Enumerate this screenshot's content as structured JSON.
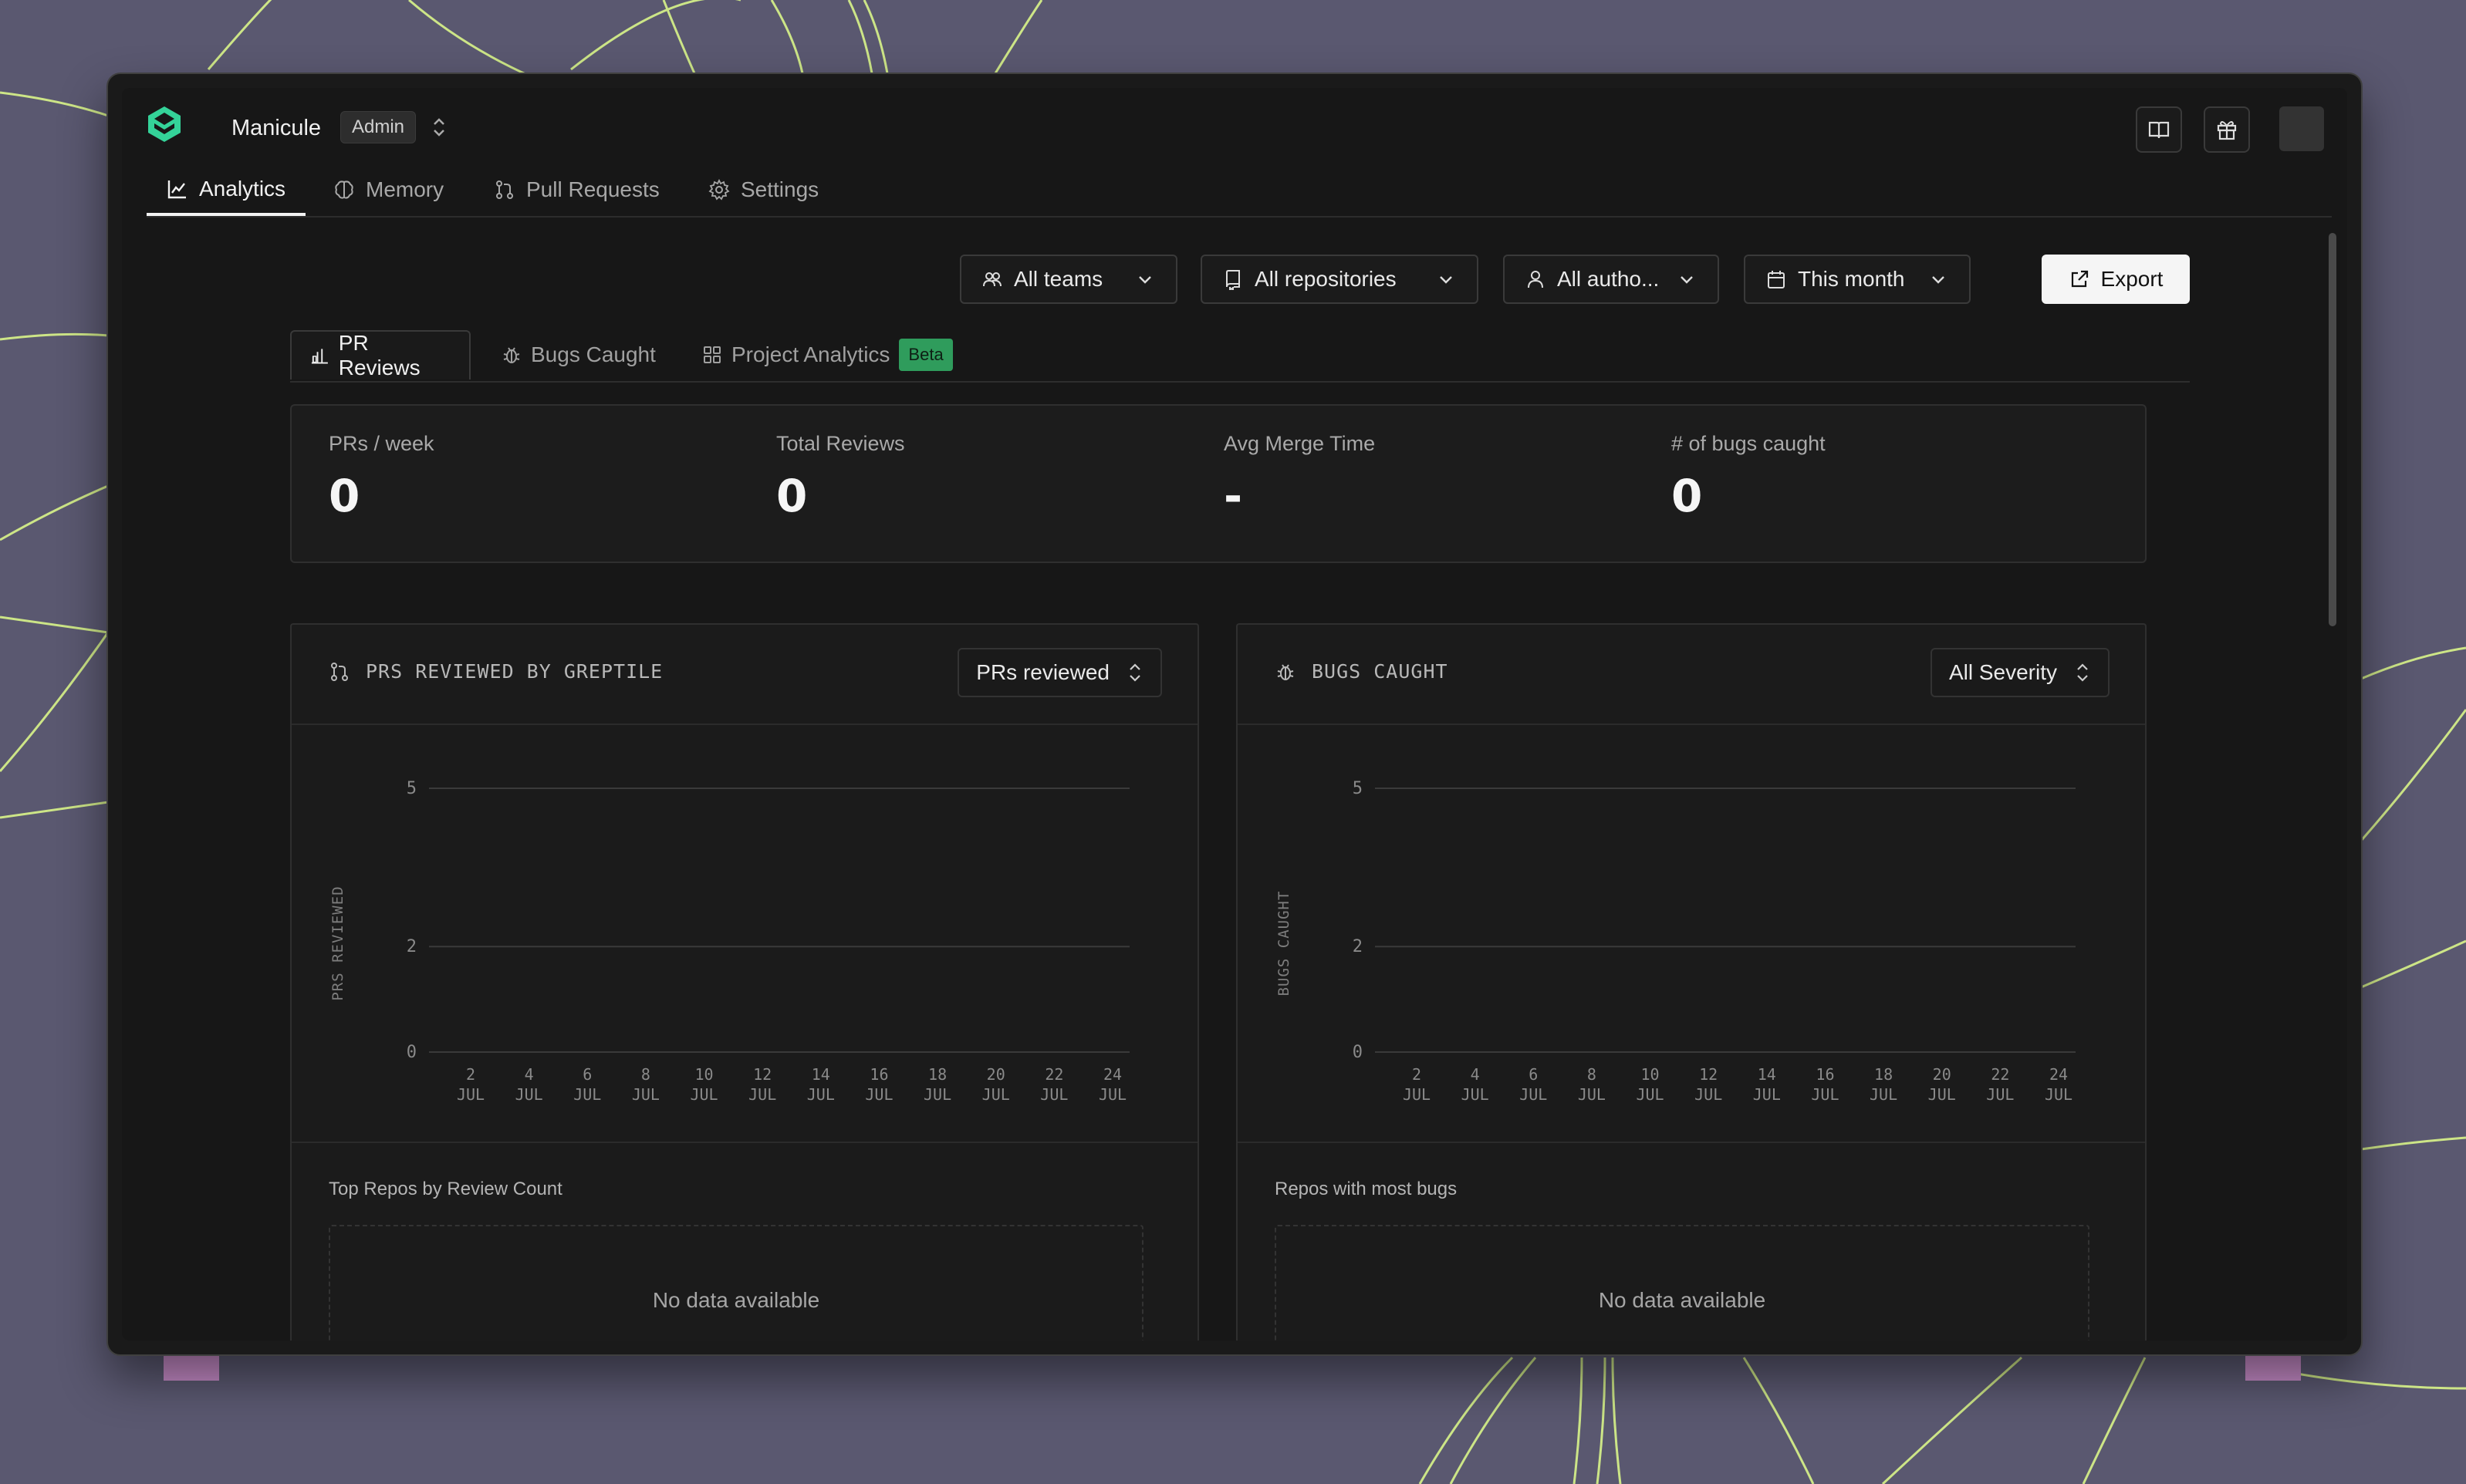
{
  "org": {
    "name": "Manicule",
    "role": "Admin"
  },
  "icons": {
    "logo": "greptile-logo-icon",
    "docs": "book-open-icon",
    "gift": "gift-icon"
  },
  "nav": {
    "tabs": [
      {
        "label": "Analytics",
        "icon": "chart-line-icon",
        "active": true
      },
      {
        "label": "Memory",
        "icon": "brain-icon",
        "active": false
      },
      {
        "label": "Pull Requests",
        "icon": "git-pull-request-icon",
        "active": false
      },
      {
        "label": "Settings",
        "icon": "gear-icon",
        "active": false
      }
    ]
  },
  "filters": {
    "teams": "All teams",
    "repositories": "All repositories",
    "authors": "All autho...",
    "period": "This month",
    "export": "Export"
  },
  "subtabs": {
    "pr_reviews": "PR Reviews",
    "bugs_caught": "Bugs Caught",
    "project_analytics": "Project Analytics",
    "beta": "Beta"
  },
  "stats": [
    {
      "label": "PRs / week",
      "value": "0"
    },
    {
      "label": "Total Reviews",
      "value": "0"
    },
    {
      "label": "Avg Merge Time",
      "value": "-"
    },
    {
      "label": "# of bugs caught",
      "value": "0"
    }
  ],
  "panels": {
    "left": {
      "title": "PRS REVIEWED BY GREPTILE",
      "select": "PRs reviewed",
      "section": "Top Repos by Review Count",
      "empty": "No data available"
    },
    "right": {
      "title": "BUGS CAUGHT",
      "select": "All Severity",
      "section": "Repos with most bugs",
      "empty": "No data available"
    }
  },
  "colors": {
    "accent_green": "#2f9c5c",
    "logo_green": "#34d399",
    "background": "#171717"
  },
  "chart_data": [
    {
      "type": "line",
      "ylabel": "PRS REVIEWED",
      "y_ticks": [
        0,
        2,
        5
      ],
      "ylim": [
        0,
        5
      ],
      "x_day": [
        "2",
        "4",
        "6",
        "8",
        "10",
        "12",
        "14",
        "16",
        "18",
        "20",
        "22",
        "24"
      ],
      "x_month": "JUL",
      "series": []
    },
    {
      "type": "line",
      "ylabel": "BUGS CAUGHT",
      "y_ticks": [
        0,
        2,
        5
      ],
      "ylim": [
        0,
        5
      ],
      "x_day": [
        "2",
        "4",
        "6",
        "8",
        "10",
        "12",
        "14",
        "16",
        "18",
        "20",
        "22",
        "24"
      ],
      "x_month": "JUL",
      "series": []
    }
  ]
}
